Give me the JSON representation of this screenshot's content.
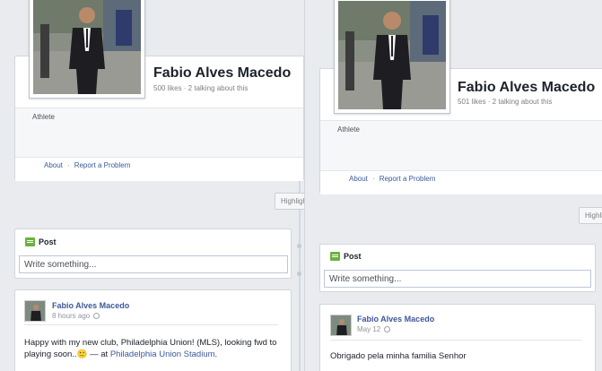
{
  "left": {
    "page_name": "Fabio Alves Macedo",
    "stats": "500 likes · 2 talking about this",
    "category": "Athlete",
    "links": {
      "about": "About",
      "sep": "·",
      "report": "Report a Problem"
    },
    "highlights_label": "Highlights",
    "composer": {
      "title": "Post",
      "placeholder": "Write something..."
    },
    "post": {
      "author": "Fabio Alves Macedo",
      "time": "8 hours ago",
      "text_before": "Happy with my new club, Philadelphia Union! (MLS), looking fwd to playing soon..",
      "emoji": "🙂",
      "text_mid": " — at ",
      "place": "Philadelphia Union Stadium",
      "text_after": "."
    }
  },
  "right": {
    "page_name": "Fabio Alves Macedo",
    "stats": "501 likes · 2 talking about this",
    "category": "Athlete",
    "links": {
      "about": "About",
      "sep": "·",
      "report": "Report a Problem"
    },
    "highlights_label": "Highlights",
    "composer": {
      "title": "Post",
      "placeholder": "Write something..."
    },
    "post": {
      "author": "Fabio Alves Macedo",
      "time": "May 12",
      "text": "Obrigado pela minha familia Senhor"
    }
  },
  "colors": {
    "link": "#3b5998",
    "post_icon": "#6ab23f",
    "background": "#e9ebee"
  }
}
